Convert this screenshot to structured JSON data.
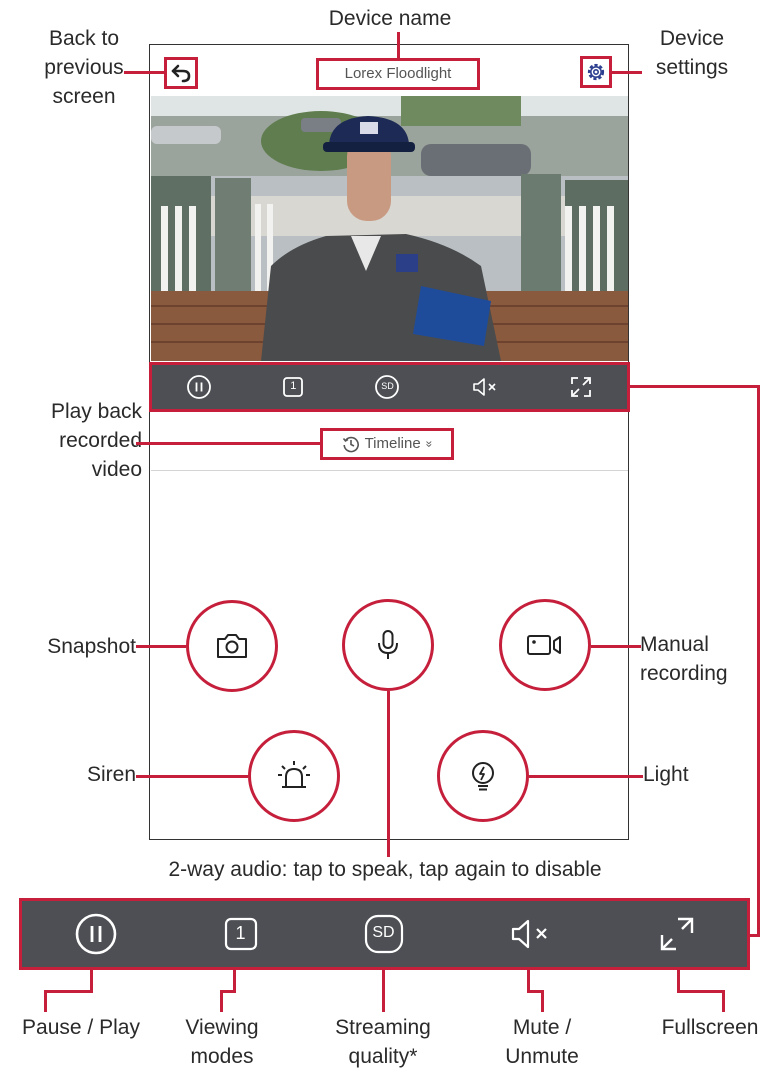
{
  "app": {
    "device_name": "Lorex Floodlight",
    "timeline_label": "Timeline",
    "timeline_chevron": "»"
  },
  "annotations": {
    "device_name": "Device name",
    "back_line1": "Back to",
    "back_line2": "previous",
    "back_line3": "screen",
    "settings_line1": "Device",
    "settings_line2": "settings",
    "playback_line1": "Play back",
    "playback_line2": "recorded",
    "playback_line3": "video",
    "snapshot": "Snapshot",
    "manual_line1": "Manual",
    "manual_line2": "recording",
    "siren": "Siren",
    "light": "Light",
    "two_way_audio": "2-way audio: tap to speak, tap again to disable",
    "pause_play": "Pause / Play",
    "viewing_line1": "Viewing",
    "viewing_line2": "modes",
    "quality_line1": "Streaming",
    "quality_line2": "quality*",
    "mute_line1": "Mute /",
    "mute_line2": "Unmute",
    "fullscreen": "Fullscreen"
  },
  "controls": {
    "viewing_mode_value": "1",
    "quality_value": "SD"
  },
  "colors": {
    "accent": "#c51f3b",
    "bar": "#4d4f54"
  },
  "icons": [
    "back-arrow-icon",
    "gear-icon",
    "pause-icon",
    "viewing-mode-icon",
    "sd-icon",
    "mute-icon",
    "fullscreen-icon",
    "history-icon",
    "camera-icon",
    "microphone-icon",
    "video-record-icon",
    "siren-icon",
    "light-bulb-icon"
  ]
}
